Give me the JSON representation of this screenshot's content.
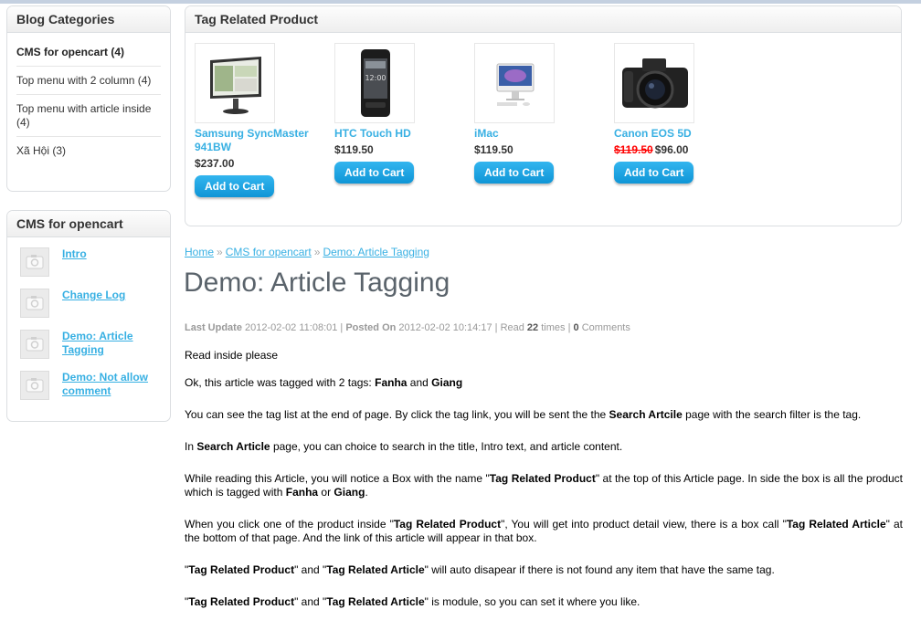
{
  "blog_categories": {
    "title": "Blog Categories",
    "items": [
      {
        "label": "CMS for opencart (4)"
      },
      {
        "label": "Top menu with 2 column (4)"
      },
      {
        "label": "Top menu with article inside (4)"
      },
      {
        "label": "Xã Hội (3)"
      }
    ]
  },
  "cms_box": {
    "title": "CMS for opencart",
    "items": [
      {
        "label": "Intro",
        "icon": "image-placeholder-icon"
      },
      {
        "label": "Change Log",
        "icon": "image-placeholder-icon"
      },
      {
        "label": "Demo: Article Tagging",
        "icon": "image-placeholder-icon"
      },
      {
        "label": "Demo: Not allow comment",
        "icon": "image-placeholder-icon"
      }
    ]
  },
  "tag_related": {
    "title": "Tag Related Product",
    "button_label": "Add to Cart",
    "products": [
      {
        "name": "Samsung SyncMaster 941BW",
        "price": "$237.00",
        "old_price": ""
      },
      {
        "name": "HTC Touch HD",
        "price": "$119.50",
        "old_price": ""
      },
      {
        "name": "iMac",
        "price": "$119.50",
        "old_price": ""
      },
      {
        "name": "Canon EOS 5D",
        "price": "$96.00",
        "old_price": "$119.50"
      }
    ]
  },
  "breadcrumb": {
    "items": [
      "Home",
      "CMS for opencart",
      "Demo: Article Tagging"
    ],
    "separator": "»"
  },
  "article": {
    "title": "Demo: Article Tagging",
    "meta": {
      "last_update_label": "Last Update",
      "last_update": "2012-02-02 11:08:01",
      "posted_on_label": "Posted On",
      "posted_on": "2012-02-02 10:14:17",
      "read_label": "Read",
      "read_count": "22",
      "read_suffix": "times",
      "comments_count": "0",
      "comments_label": "Comments"
    },
    "intro": "Read inside please",
    "p1": {
      "text": "Ok, this article was tagged with 2 tags: ",
      "tag1": "Fanha",
      "and": " and ",
      "tag2": "Giang"
    },
    "p2": {
      "a": "You can see the tag list at the end of page. By click the tag link, you will be sent the the ",
      "b": "Search Artcile",
      "c": " page with the search filter is the tag."
    },
    "p3": {
      "a": "In ",
      "b": "Search Article",
      "c": " page, you can choice to search in the title, Intro text, and article content."
    },
    "p4": {
      "a": "While reading this Article, you will notice a Box with the name \"",
      "b": "Tag Related Product",
      "c": "\" at the top of this Article page. In side the box is all the product which is tagged with ",
      "d": "Fanha",
      "e": " or ",
      "f": "Giang",
      "g": "."
    },
    "p5": {
      "a": "When you click one of the product inside \"",
      "b": "Tag Related Product",
      "c": "\", You will get into product detail view, there is a box call \"",
      "d": "Tag Related Article",
      "e": "\" at the bottom of that page. And the link of this article will appear in that box."
    },
    "p6": {
      "a": "\"",
      "b": "Tag Related Product",
      "c": "\" and \"",
      "d": "Tag Related Article",
      "e": "\" will auto disapear if there is not found any item that have the same tag."
    },
    "p7": {
      "a": "\"",
      "b": "Tag Related Product",
      "c": "\" and \"",
      "d": "Tag Related Article",
      "e": "\" is module, so you can set it where you like."
    }
  },
  "colors": {
    "link": "#38b0e3",
    "button": "#1aa3e3",
    "old_price": "#ff0000",
    "title": "#5a636b"
  }
}
